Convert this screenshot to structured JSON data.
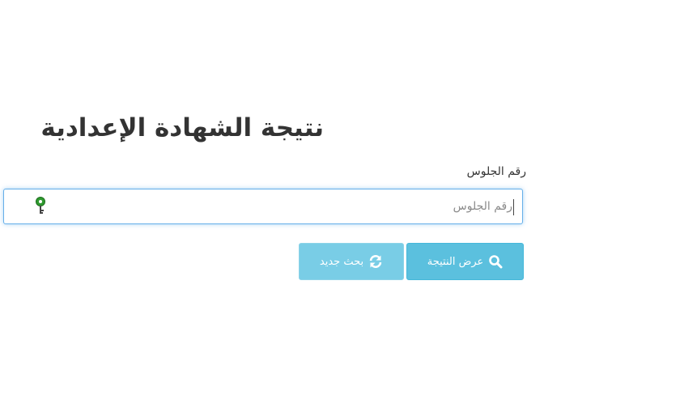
{
  "page": {
    "title": "نتيجة الشهادة الإعدادية"
  },
  "form": {
    "seat_label": "رقم الجلوس",
    "seat_placeholder": "رقم الجلوس",
    "seat_value": ""
  },
  "buttons": {
    "show_result": "عرض النتيجة",
    "new_search": "بحث جديد"
  },
  "icons": {
    "show_result_icon": "search-icon",
    "new_search_icon": "refresh-icon",
    "autofill_icon": "key-icon"
  },
  "colors": {
    "primary_button": "#5bc0de",
    "secondary_button": "#79cde6",
    "input_focus": "#66afe9",
    "key_icon": "#2f9a2f",
    "title_text": "#333333"
  }
}
